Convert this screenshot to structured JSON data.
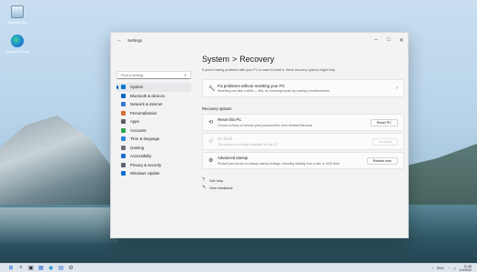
{
  "desktop": {
    "icons": [
      {
        "label": "Recycle Bin"
      },
      {
        "label": "Microsoft Edge"
      }
    ]
  },
  "window": {
    "app_title": "Settings",
    "controls": {
      "minimize": "–",
      "maximize": "□",
      "close": "✕"
    }
  },
  "sidebar": {
    "search_placeholder": "Find a setting",
    "items": [
      {
        "label": "System",
        "icon": "system-icon",
        "color": "#0078d4",
        "active": true
      },
      {
        "label": "Bluetooth & devices",
        "icon": "bluetooth-icon",
        "color": "#0067c0"
      },
      {
        "label": "Network & internet",
        "icon": "network-icon",
        "color": "#3a7bd5"
      },
      {
        "label": "Personalization",
        "icon": "brush-icon",
        "color": "#d06e2e"
      },
      {
        "label": "Apps",
        "icon": "apps-icon",
        "color": "#5a5f66"
      },
      {
        "label": "Accounts",
        "icon": "accounts-icon",
        "color": "#2ea44f"
      },
      {
        "label": "Time & language",
        "icon": "time-icon",
        "color": "#2b88d8"
      },
      {
        "label": "Gaming",
        "icon": "gaming-icon",
        "color": "#6b6f75"
      },
      {
        "label": "Accessibility",
        "icon": "accessibility-icon",
        "color": "#1f6fd1"
      },
      {
        "label": "Privacy & security",
        "icon": "shield-icon",
        "color": "#5a6470"
      },
      {
        "label": "Windows Update",
        "icon": "update-icon",
        "color": "#0b6ccf"
      }
    ]
  },
  "main": {
    "breadcrumb_parent": "System",
    "breadcrumb_sep": ">",
    "page_title": "Recovery",
    "subtitle": "If you're having problems with your PC or want to reset it, these recovery options might help.",
    "fix_card": {
      "title": "Fix problems without resetting your PC",
      "desc": "Resetting can take a while — first, try resolving issues by running a troubleshooter"
    },
    "section_label": "Recovery options",
    "options": [
      {
        "title": "Reset this PC",
        "desc": "Choose to keep or remove your personal files, then reinstall Windows",
        "button": "Reset PC",
        "disabled": false
      },
      {
        "title": "Go back",
        "desc": "This option is no longer available on this PC",
        "button": "Go back",
        "disabled": true
      },
      {
        "title": "Advanced startup",
        "desc": "Restart your device to change startup settings, including starting from a disc or USB drive",
        "button": "Restart now",
        "disabled": false
      }
    ],
    "links": [
      {
        "label": "Get help",
        "icon": "help-icon"
      },
      {
        "label": "Give feedback",
        "icon": "feedback-icon"
      }
    ]
  },
  "taskbar": {
    "apps": [
      "windows-start-icon",
      "search-icon",
      "task-view-icon",
      "widgets-icon",
      "edge-icon",
      "store-icon",
      "settings-icon"
    ],
    "lang": "ENG",
    "clock_time": "11:45",
    "clock_date": "1/1/2022"
  }
}
